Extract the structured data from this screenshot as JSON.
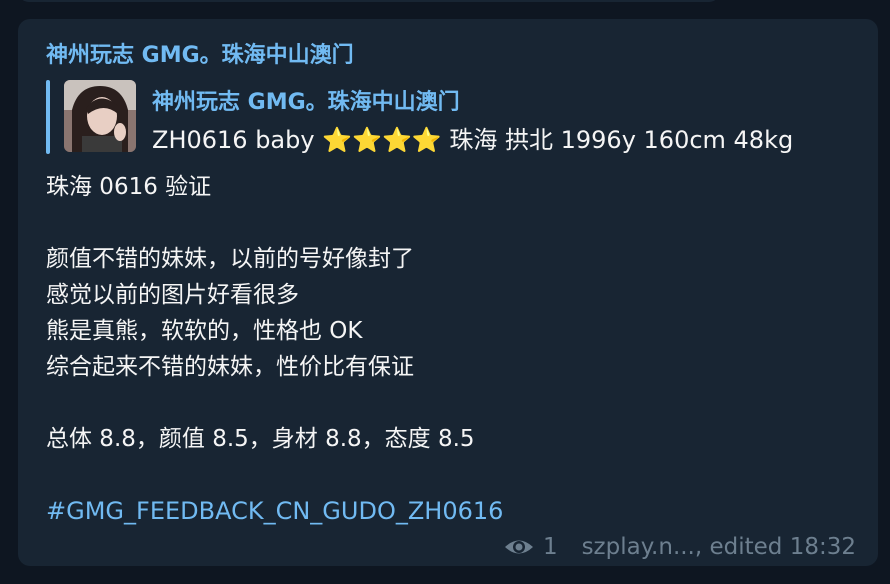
{
  "message": {
    "sender": "神州玩志 GMG。珠海中山澳门",
    "reply": {
      "title": "神州玩志 GMG。珠海中山澳门",
      "text": "ZH0616 baby ⭐⭐⭐⭐ 珠海 拱北 1996y 160cm 48kg"
    },
    "lines": [
      "珠海 0616 验证",
      "",
      "颜值不错的妹妹，以前的号好像封了",
      "感觉以前的图片好看很多",
      "熊是真熊，软软的，性格也 OK",
      "综合起来不错的妹妹，性价比有保证",
      "",
      "总体 8.8，颜值 8.5，身材 8.8，态度 8.5",
      ""
    ],
    "hashtag": "#GMG_FEEDBACK_CN_GUDO_ZH0616",
    "views": "1",
    "signature": "szplay.n..., edited 18:32"
  },
  "colors": {
    "background": "#0e1621",
    "bubble": "#182533",
    "accent": "#71baf2",
    "meta": "#6d7f8f"
  }
}
